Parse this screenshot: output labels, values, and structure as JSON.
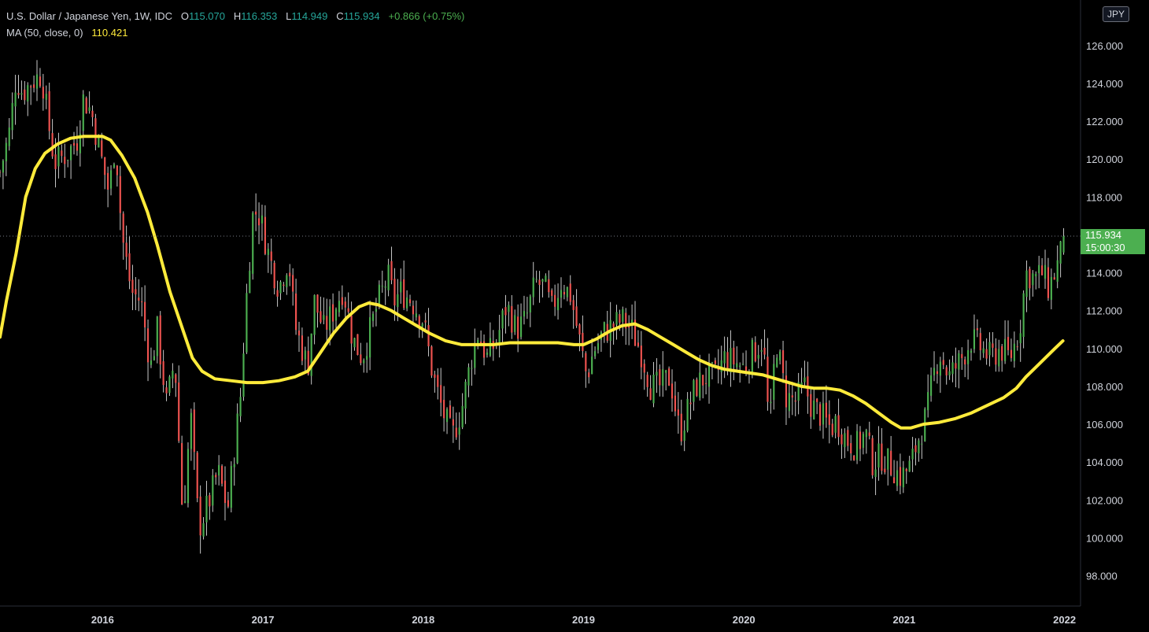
{
  "header": {
    "title": "U.S. Dollar / Japanese Yen, 1W, IDC",
    "o_label": "O",
    "o_value": "115.070",
    "h_label": "H",
    "h_value": "116.353",
    "l_label": "L",
    "l_value": "114.949",
    "c_label": "C",
    "c_value": "115.934",
    "change": "+0.866 (+0.75%)"
  },
  "indicator": {
    "label": "MA (50, close, 0)",
    "value": "110.421",
    "color": "#ffeb3b"
  },
  "currency_badge": "JPY",
  "last_price": {
    "price": "115.934",
    "countdown": "15:00:30",
    "color": "#4caf50"
  },
  "colors": {
    "up": "#4caf50",
    "down": "#ef5350",
    "background": "#000000",
    "ma": "#ffeb3b"
  },
  "chart_data": {
    "type": "candlestick",
    "title": "U.S. Dollar / Japanese Yen, 1W, IDC",
    "ylim": [
      96.4,
      128.4
    ],
    "xlim": [
      2015.36,
      2022.1
    ],
    "y_ticks": [
      "98.000",
      "100.000",
      "102.000",
      "104.000",
      "106.000",
      "108.000",
      "110.000",
      "112.000",
      "114.000",
      "116.000",
      "118.000",
      "120.000",
      "122.000",
      "124.000",
      "126.000"
    ],
    "x_ticks": [
      {
        "label": "2016",
        "x": 2016
      },
      {
        "label": "2017",
        "x": 2017
      },
      {
        "label": "2018",
        "x": 2018
      },
      {
        "label": "2019",
        "x": 2019
      },
      {
        "label": "2020",
        "x": 2020
      },
      {
        "label": "2021",
        "x": 2021
      },
      {
        "label": "2022",
        "x": 2022
      }
    ],
    "price_anchors": [
      [
        2015.36,
        119.3
      ],
      [
        2015.42,
        121.5
      ],
      [
        2015.46,
        124.3
      ],
      [
        2015.5,
        123.5
      ],
      [
        2015.56,
        124.1
      ],
      [
        2015.62,
        124.5
      ],
      [
        2015.66,
        122.0
      ],
      [
        2015.7,
        119.8
      ],
      [
        2015.78,
        120.3
      ],
      [
        2015.84,
        121.0
      ],
      [
        2015.88,
        123.2
      ],
      [
        2015.93,
        122.5
      ],
      [
        2015.98,
        120.5
      ],
      [
        2016.04,
        118.2
      ],
      [
        2016.08,
        121.0
      ],
      [
        2016.12,
        116.0
      ],
      [
        2016.18,
        113.0
      ],
      [
        2016.24,
        112.5
      ],
      [
        2016.3,
        109.0
      ],
      [
        2016.34,
        111.0
      ],
      [
        2016.4,
        107.0
      ],
      [
        2016.45,
        109.5
      ],
      [
        2016.5,
        101.0
      ],
      [
        2016.55,
        106.5
      ],
      [
        2016.6,
        100.5
      ],
      [
        2016.66,
        101.8
      ],
      [
        2016.72,
        103.5
      ],
      [
        2016.78,
        101.5
      ],
      [
        2016.82,
        104.5
      ],
      [
        2016.86,
        107.5
      ],
      [
        2016.9,
        113.0
      ],
      [
        2016.94,
        117.3
      ],
      [
        2016.98,
        117.0
      ],
      [
        2017.04,
        114.8
      ],
      [
        2017.1,
        113.2
      ],
      [
        2017.16,
        114.8
      ],
      [
        2017.2,
        111.2
      ],
      [
        2017.28,
        109.0
      ],
      [
        2017.32,
        112.5
      ],
      [
        2017.38,
        111.0
      ],
      [
        2017.44,
        112.0
      ],
      [
        2017.5,
        113.2
      ],
      [
        2017.56,
        110.5
      ],
      [
        2017.62,
        109.5
      ],
      [
        2017.68,
        111.3
      ],
      [
        2017.72,
        112.5
      ],
      [
        2017.78,
        113.8
      ],
      [
        2017.82,
        112.5
      ],
      [
        2017.86,
        113.0
      ],
      [
        2017.92,
        112.6
      ],
      [
        2018.0,
        111.5
      ],
      [
        2018.06,
        108.6
      ],
      [
        2018.12,
        106.7
      ],
      [
        2018.18,
        105.3
      ],
      [
        2018.24,
        106.8
      ],
      [
        2018.3,
        109.5
      ],
      [
        2018.34,
        110.8
      ],
      [
        2018.4,
        109.5
      ],
      [
        2018.46,
        110.5
      ],
      [
        2018.52,
        112.3
      ],
      [
        2018.58,
        111.0
      ],
      [
        2018.64,
        111.5
      ],
      [
        2018.7,
        113.5
      ],
      [
        2018.76,
        113.2
      ],
      [
        2018.8,
        112.0
      ],
      [
        2018.86,
        113.5
      ],
      [
        2018.92,
        112.8
      ],
      [
        2018.98,
        110.2
      ],
      [
        2019.02,
        108.5
      ],
      [
        2019.06,
        109.8
      ],
      [
        2019.12,
        110.8
      ],
      [
        2019.18,
        111.2
      ],
      [
        2019.24,
        111.5
      ],
      [
        2019.3,
        111.0
      ],
      [
        2019.36,
        109.8
      ],
      [
        2019.42,
        108.0
      ],
      [
        2019.48,
        108.0
      ],
      [
        2019.54,
        108.5
      ],
      [
        2019.6,
        105.5
      ],
      [
        2019.64,
        106.5
      ],
      [
        2019.7,
        108.0
      ],
      [
        2019.76,
        108.5
      ],
      [
        2019.82,
        108.5
      ],
      [
        2019.88,
        109.5
      ],
      [
        2019.94,
        109.3
      ],
      [
        2020.0,
        109.0
      ],
      [
        2020.06,
        109.8
      ],
      [
        2020.12,
        110.5
      ],
      [
        2020.16,
        105.5
      ],
      [
        2020.2,
        110.5
      ],
      [
        2020.26,
        107.5
      ],
      [
        2020.32,
        107.2
      ],
      [
        2020.38,
        108.0
      ],
      [
        2020.42,
        107.0
      ],
      [
        2020.48,
        106.5
      ],
      [
        2020.54,
        105.8
      ],
      [
        2020.58,
        106.2
      ],
      [
        2020.64,
        105.2
      ],
      [
        2020.7,
        104.8
      ],
      [
        2020.76,
        105.5
      ],
      [
        2020.8,
        104.0
      ],
      [
        2020.86,
        104.3
      ],
      [
        2020.92,
        103.8
      ],
      [
        2020.98,
        103.2
      ],
      [
        2021.04,
        103.8
      ],
      [
        2021.08,
        105.0
      ],
      [
        2021.14,
        106.5
      ],
      [
        2021.18,
        108.5
      ],
      [
        2021.22,
        109.8
      ],
      [
        2021.28,
        108.5
      ],
      [
        2021.32,
        109.0
      ],
      [
        2021.36,
        109.5
      ],
      [
        2021.42,
        110.5
      ],
      [
        2021.48,
        110.0
      ],
      [
        2021.54,
        109.5
      ],
      [
        2021.6,
        110.0
      ],
      [
        2021.66,
        109.5
      ],
      [
        2021.72,
        111.0
      ],
      [
        2021.76,
        114.0
      ],
      [
        2021.82,
        113.7
      ],
      [
        2021.86,
        114.0
      ],
      [
        2021.9,
        113.2
      ],
      [
        2021.94,
        114.0
      ],
      [
        2021.98,
        115.1
      ],
      [
        2022.01,
        115.934
      ]
    ],
    "ma50": [
      [
        2015.36,
        110.6
      ],
      [
        2015.4,
        112.5
      ],
      [
        2015.46,
        115.0
      ],
      [
        2015.52,
        118.0
      ],
      [
        2015.58,
        119.5
      ],
      [
        2015.64,
        120.3
      ],
      [
        2015.72,
        120.8
      ],
      [
        2015.8,
        121.1
      ],
      [
        2015.88,
        121.2
      ],
      [
        2016.0,
        121.2
      ],
      [
        2016.05,
        121.0
      ],
      [
        2016.12,
        120.2
      ],
      [
        2016.2,
        119.0
      ],
      [
        2016.28,
        117.2
      ],
      [
        2016.34,
        115.5
      ],
      [
        2016.42,
        113.0
      ],
      [
        2016.5,
        111.0
      ],
      [
        2016.56,
        109.5
      ],
      [
        2016.62,
        108.8
      ],
      [
        2016.7,
        108.4
      ],
      [
        2016.8,
        108.3
      ],
      [
        2016.9,
        108.2
      ],
      [
        2017.0,
        108.2
      ],
      [
        2017.1,
        108.3
      ],
      [
        2017.2,
        108.5
      ],
      [
        2017.28,
        108.8
      ],
      [
        2017.36,
        109.8
      ],
      [
        2017.44,
        110.8
      ],
      [
        2017.52,
        111.6
      ],
      [
        2017.6,
        112.2
      ],
      [
        2017.66,
        112.4
      ],
      [
        2017.72,
        112.3
      ],
      [
        2017.8,
        112.0
      ],
      [
        2017.88,
        111.6
      ],
      [
        2017.96,
        111.2
      ],
      [
        2018.04,
        110.8
      ],
      [
        2018.14,
        110.4
      ],
      [
        2018.24,
        110.2
      ],
      [
        2018.34,
        110.2
      ],
      [
        2018.44,
        110.2
      ],
      [
        2018.54,
        110.3
      ],
      [
        2018.64,
        110.3
      ],
      [
        2018.74,
        110.3
      ],
      [
        2018.84,
        110.3
      ],
      [
        2018.94,
        110.2
      ],
      [
        2019.0,
        110.2
      ],
      [
        2019.08,
        110.5
      ],
      [
        2019.16,
        110.9
      ],
      [
        2019.24,
        111.2
      ],
      [
        2019.32,
        111.3
      ],
      [
        2019.4,
        111.0
      ],
      [
        2019.48,
        110.6
      ],
      [
        2019.56,
        110.2
      ],
      [
        2019.64,
        109.8
      ],
      [
        2019.72,
        109.4
      ],
      [
        2019.8,
        109.1
      ],
      [
        2019.88,
        108.9
      ],
      [
        2019.96,
        108.8
      ],
      [
        2020.04,
        108.7
      ],
      [
        2020.12,
        108.6
      ],
      [
        2020.2,
        108.4
      ],
      [
        2020.28,
        108.2
      ],
      [
        2020.36,
        108.0
      ],
      [
        2020.44,
        107.9
      ],
      [
        2020.52,
        107.9
      ],
      [
        2020.6,
        107.8
      ],
      [
        2020.68,
        107.5
      ],
      [
        2020.76,
        107.1
      ],
      [
        2020.84,
        106.6
      ],
      [
        2020.92,
        106.1
      ],
      [
        2020.98,
        105.8
      ],
      [
        2021.04,
        105.8
      ],
      [
        2021.12,
        106.0
      ],
      [
        2021.22,
        106.1
      ],
      [
        2021.32,
        106.3
      ],
      [
        2021.42,
        106.6
      ],
      [
        2021.52,
        107.0
      ],
      [
        2021.62,
        107.4
      ],
      [
        2021.7,
        107.9
      ],
      [
        2021.76,
        108.5
      ],
      [
        2021.82,
        109.0
      ],
      [
        2021.88,
        109.5
      ],
      [
        2021.94,
        110.0
      ],
      [
        2021.99,
        110.4
      ]
    ],
    "current_price": 115.934
  }
}
